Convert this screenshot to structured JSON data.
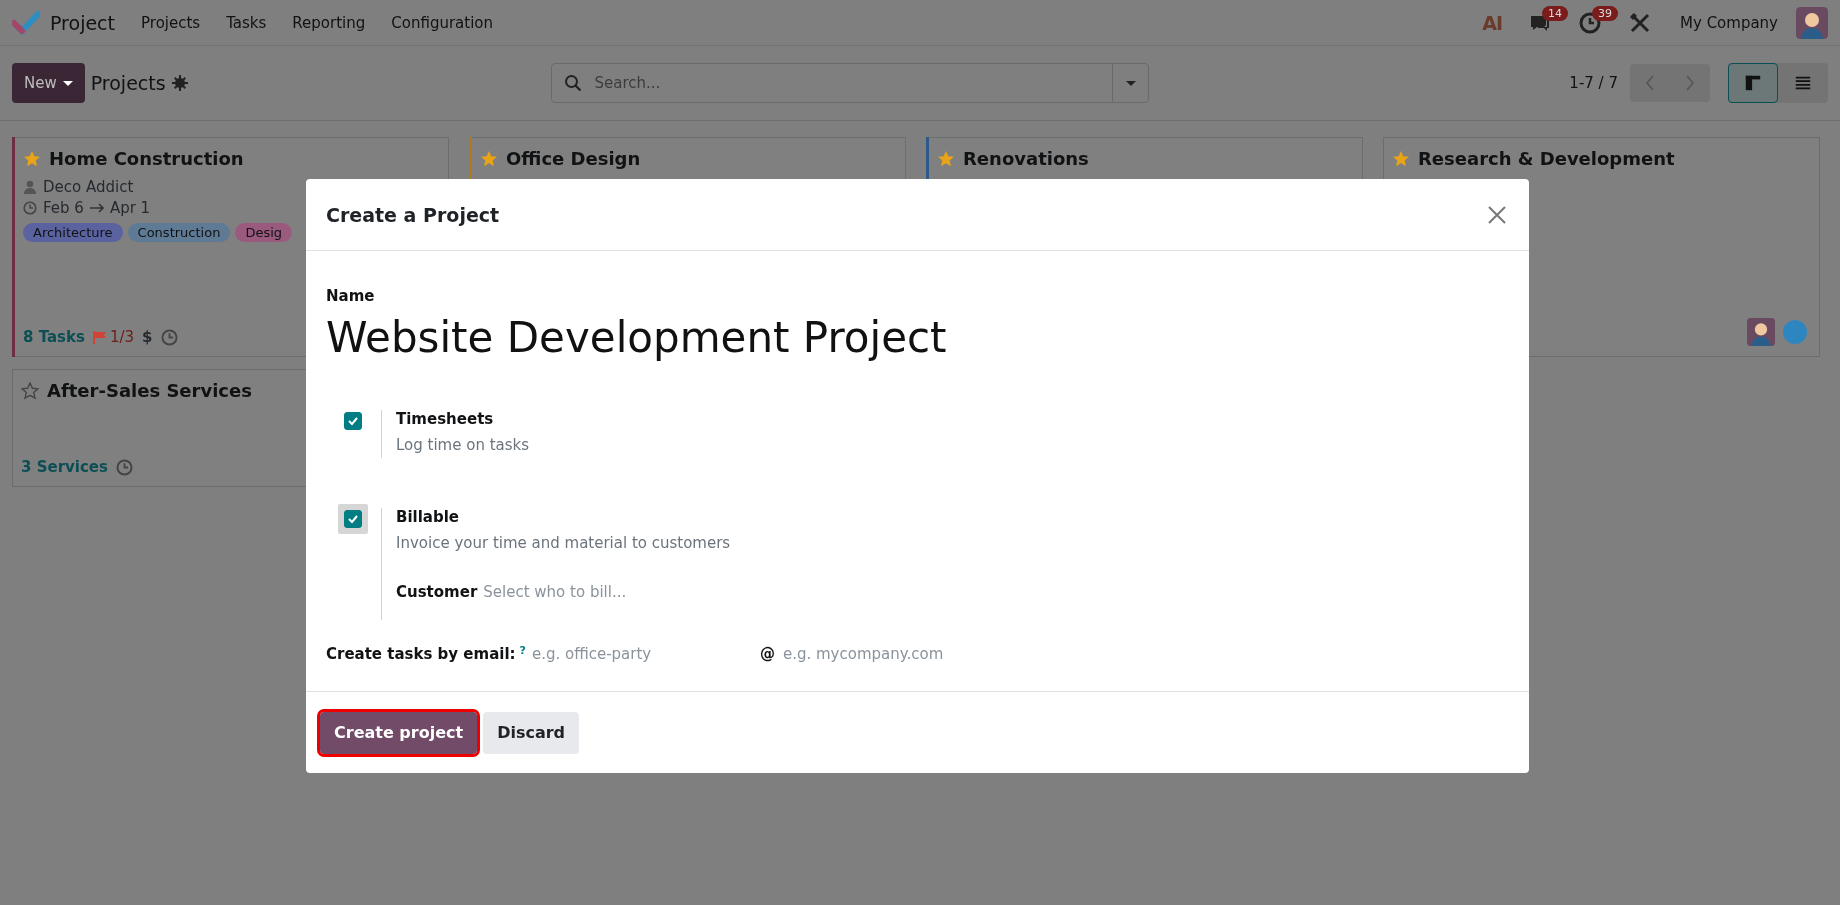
{
  "navbar": {
    "app_name": "Project",
    "menu": [
      "Projects",
      "Tasks",
      "Reporting",
      "Configuration"
    ],
    "systray": [
      {
        "kind": "ai",
        "text": "AI"
      },
      {
        "kind": "chat",
        "badge": "14"
      },
      {
        "kind": "activity",
        "badge": "39"
      },
      {
        "kind": "tools"
      }
    ],
    "company": "My Company"
  },
  "control_panel": {
    "new_button": "New",
    "title": "Projects",
    "search": {
      "placeholder": "Search..."
    },
    "pager": "1-7 / 7",
    "views": [
      {
        "kind": "kanban",
        "selected": true
      },
      {
        "kind": "list",
        "selected": false
      }
    ]
  },
  "cards": [
    {
      "title": "Home Construction",
      "favorite": true,
      "color": "#6e2f46",
      "customer": "Deco Addict",
      "date_start": "Feb 6",
      "date_end": "Apr 1",
      "tags": [
        {
          "label": "Architecture",
          "color": "#5a63a0"
        },
        {
          "label": "Construction",
          "color": "#5f7a95"
        },
        {
          "label": "Desig",
          "color": "#9a5a7e"
        }
      ],
      "count": "8 Tasks",
      "milestones": "1/3",
      "money": "$",
      "clock": true
    },
    {
      "title": "Office Design",
      "favorite": true,
      "color": "#b07a1a"
    },
    {
      "title": "Renovations",
      "favorite": true,
      "color": "#2d5a8a"
    },
    {
      "title": "Research & Development",
      "favorite": true,
      "avatars": [
        {
          "kind": "person"
        },
        {
          "kind": "circle"
        }
      ]
    },
    {
      "title": "After-Sales Services",
      "favorite": false,
      "count": "3 Services",
      "clock": true
    }
  ],
  "dialog": {
    "title": "Create a Project",
    "name_label": "Name",
    "name_value": "Website Development Project",
    "options": [
      {
        "label": "Timesheets",
        "description": "Log time on tasks",
        "checked": true,
        "focused": false
      },
      {
        "label": "Billable",
        "description": "Invoice your time and material to customers",
        "checked": true,
        "focused": true,
        "field": {
          "label": "Customer",
          "placeholder": "Select who to bill..."
        }
      }
    ],
    "email": {
      "label": "Create tasks by email:",
      "help": "?",
      "alias_placeholder": "e.g. office-party",
      "at": "@",
      "domain_placeholder": "e.g. mycompany.com"
    },
    "buttons": [
      {
        "label": "Create project",
        "kind": "primary",
        "highlighted": true
      },
      {
        "label": "Discard",
        "kind": "secondary",
        "highlighted": false
      }
    ]
  }
}
